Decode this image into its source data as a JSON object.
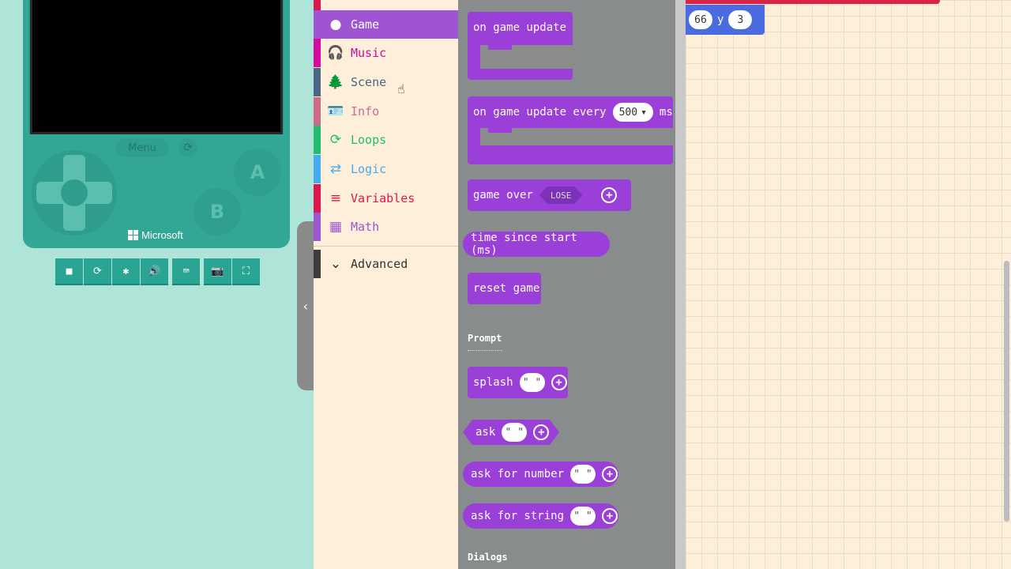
{
  "simulator": {
    "menu_label": "Menu",
    "button_a": "A",
    "button_b": "B",
    "brand": "Microsoft",
    "toolbar": [
      {
        "icon": "stop-icon",
        "glyph": "■"
      },
      {
        "icon": "restart-icon",
        "glyph": "⟳"
      },
      {
        "icon": "debug-icon",
        "glyph": "✱"
      },
      {
        "icon": "sound-icon",
        "glyph": "🔊"
      },
      {
        "icon": "keyboard-icon",
        "glyph": "⌨"
      },
      {
        "icon": "screenshot-icon",
        "glyph": "📷"
      },
      {
        "icon": "fullscreen-icon",
        "glyph": "⛶"
      }
    ]
  },
  "toolbox": {
    "categories": [
      {
        "label": "Game",
        "icon": "circle-icon",
        "glyph": "●",
        "color": "#9f54d4"
      },
      {
        "label": "Music",
        "icon": "headphones-icon",
        "glyph": "🎧",
        "color": "#d6089d"
      },
      {
        "label": "Scene",
        "icon": "tree-icon",
        "glyph": "🌲",
        "color": "#4b6584"
      },
      {
        "label": "Info",
        "icon": "id-card-icon",
        "glyph": "🪪",
        "color": "#cf6a87"
      },
      {
        "label": "Loops",
        "icon": "loop-icon",
        "glyph": "⟳",
        "color": "#20bf6b"
      },
      {
        "label": "Logic",
        "icon": "shuffle-icon",
        "glyph": "⇄",
        "color": "#45aaf2"
      },
      {
        "label": "Variables",
        "icon": "list-icon",
        "glyph": "≡",
        "color": "#e1154d"
      },
      {
        "label": "Math",
        "icon": "calculator-icon",
        "glyph": "▦",
        "color": "#9f54d4"
      }
    ],
    "advanced_label": "Advanced",
    "advanced_color": "#3c3c3c"
  },
  "flyout": {
    "blocks": {
      "on_game_update": "on game update",
      "on_game_update_every": "on game update every",
      "every_value": "500",
      "every_unit": "ms",
      "game_over": "game over",
      "lose_tag": "LOSE",
      "time_since_start": "time since start (ms)",
      "reset_game": "reset game",
      "splash": "splash",
      "ask": "ask",
      "ask_for_number": "ask for number",
      "ask_for_string": "ask for string",
      "empty_string": "\" \""
    },
    "section_prompt": "Prompt",
    "section_dialogs": "Dialogs",
    "block_color": "#9b3fd9"
  },
  "workspace": {
    "x_value": "66",
    "y_label": "y",
    "y_value": "3"
  }
}
